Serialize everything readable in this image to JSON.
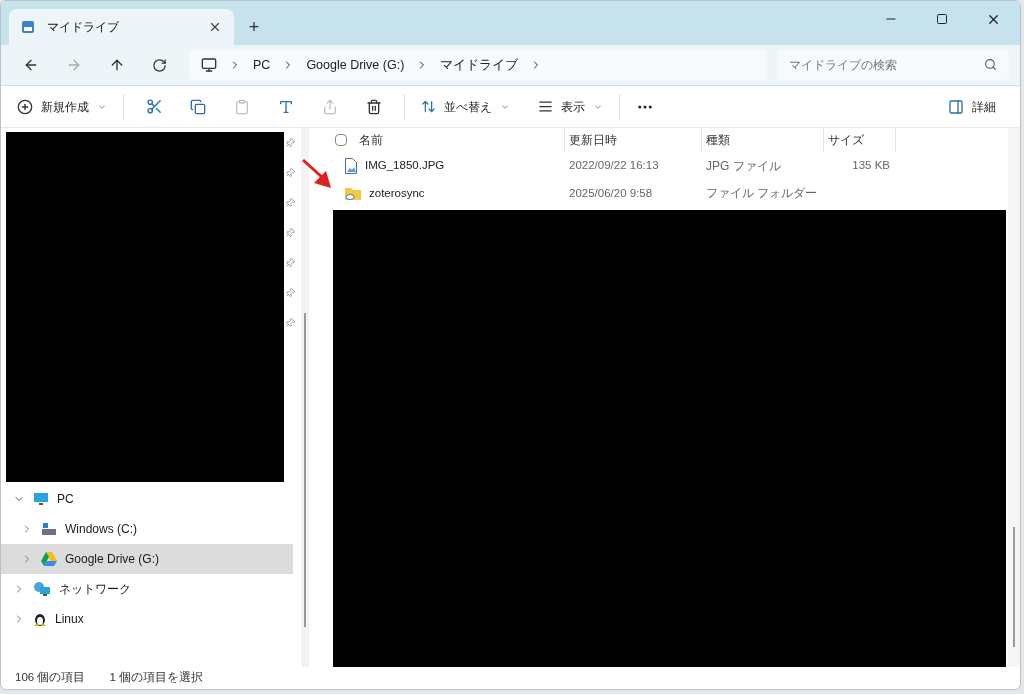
{
  "window": {
    "tab_title": "マイドライブ",
    "new_tab": "+"
  },
  "address_bar": {
    "breadcrumbs": [
      "PC",
      "Google Drive (G:)",
      "マイドライブ"
    ]
  },
  "search": {
    "placeholder": "マイドライブの検索"
  },
  "toolbar": {
    "new": "新規作成",
    "sort": "並べ替え",
    "view": "表示",
    "details": "詳細"
  },
  "nav": {
    "items": [
      {
        "label": "PC",
        "kind": "pc",
        "expanded": true,
        "selected": false,
        "children": [
          {
            "label": "Windows (C:)",
            "kind": "drive",
            "expanded": false,
            "selected": false
          },
          {
            "label": "Google Drive (G:)",
            "kind": "cloud-drive",
            "expanded": false,
            "selected": true
          }
        ]
      },
      {
        "label": "ネットワーク",
        "kind": "network",
        "expanded": false,
        "selected": false
      },
      {
        "label": "Linux",
        "kind": "linux",
        "expanded": false,
        "selected": false
      }
    ]
  },
  "table": {
    "select_all": {
      "checked": false
    },
    "columns": [
      "名前",
      "更新日時",
      "種類",
      "サイズ"
    ],
    "rows": [
      {
        "kind": "image",
        "name": "IMG_1850.JPG",
        "modified": "2022/09/22 16:13",
        "type": "JPG ファイル",
        "size": "135 KB"
      },
      {
        "kind": "folder",
        "name": "zoterosync",
        "modified": "2025/06/20 9:58",
        "type": "ファイル フォルダー"
      }
    ]
  },
  "status_bar": [
    "106 個の項目",
    "1 個の項目を選択"
  ]
}
